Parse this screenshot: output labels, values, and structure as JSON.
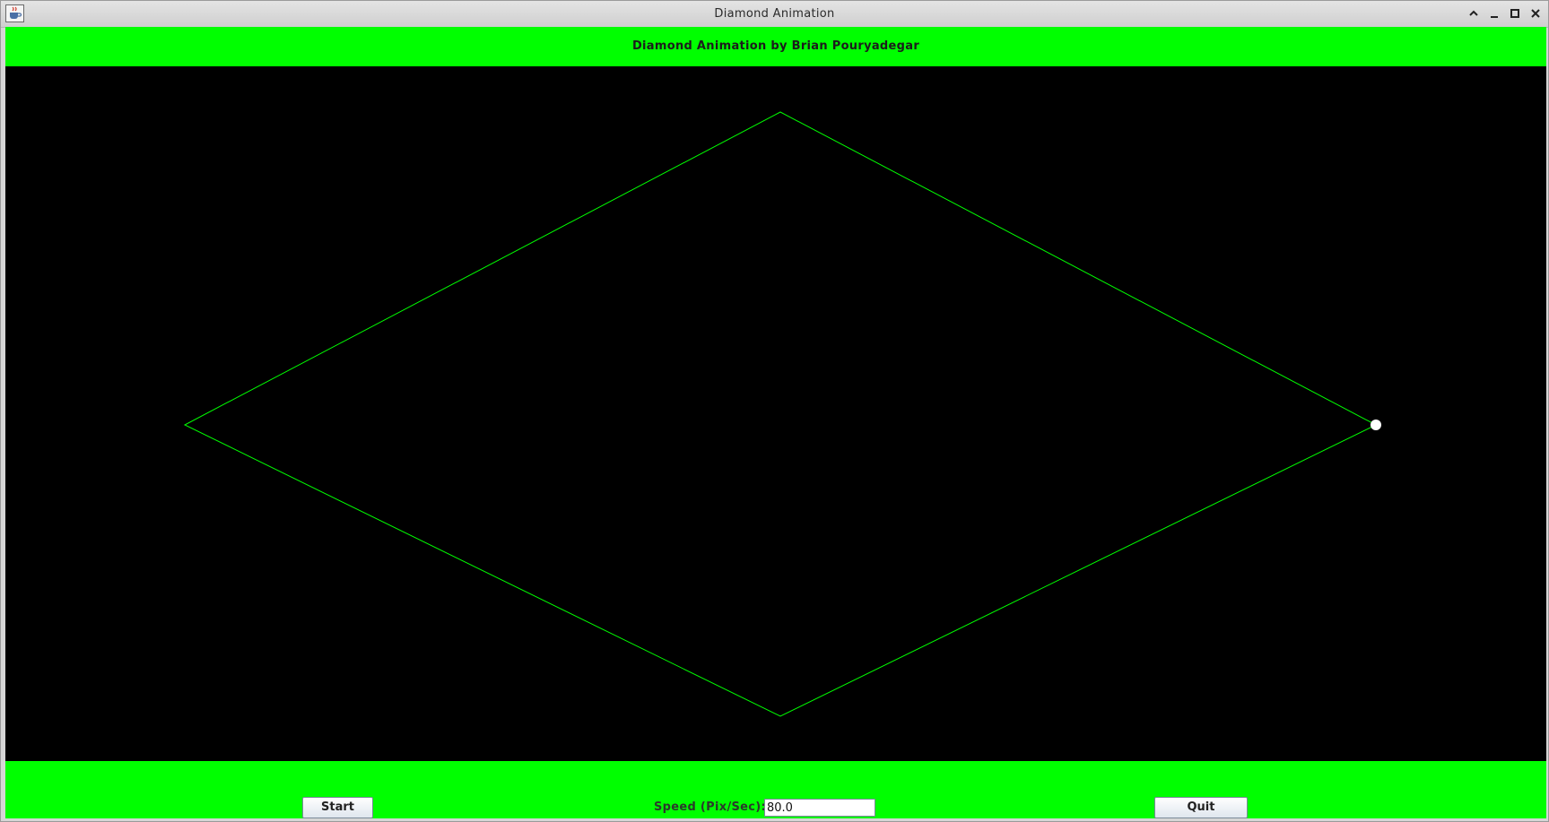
{
  "window": {
    "title": "Diamond Animation",
    "app_icon": "java-cup-icon",
    "controls": [
      "roll-up-icon",
      "minimize-icon",
      "maximize-icon",
      "close-icon"
    ]
  },
  "header": {
    "text": "Diamond Animation by Brian Pouryadegar",
    "background": "#00ff00"
  },
  "canvas": {
    "background": "#000000",
    "diamond_color": "#00ff00",
    "ball_color": "#ffffff"
  },
  "controls": {
    "start_label": "Start",
    "speed_label": "Speed (Pix/Sec):",
    "speed_value": "80.0",
    "quit_label": "Quit",
    "background": "#00ff00"
  }
}
